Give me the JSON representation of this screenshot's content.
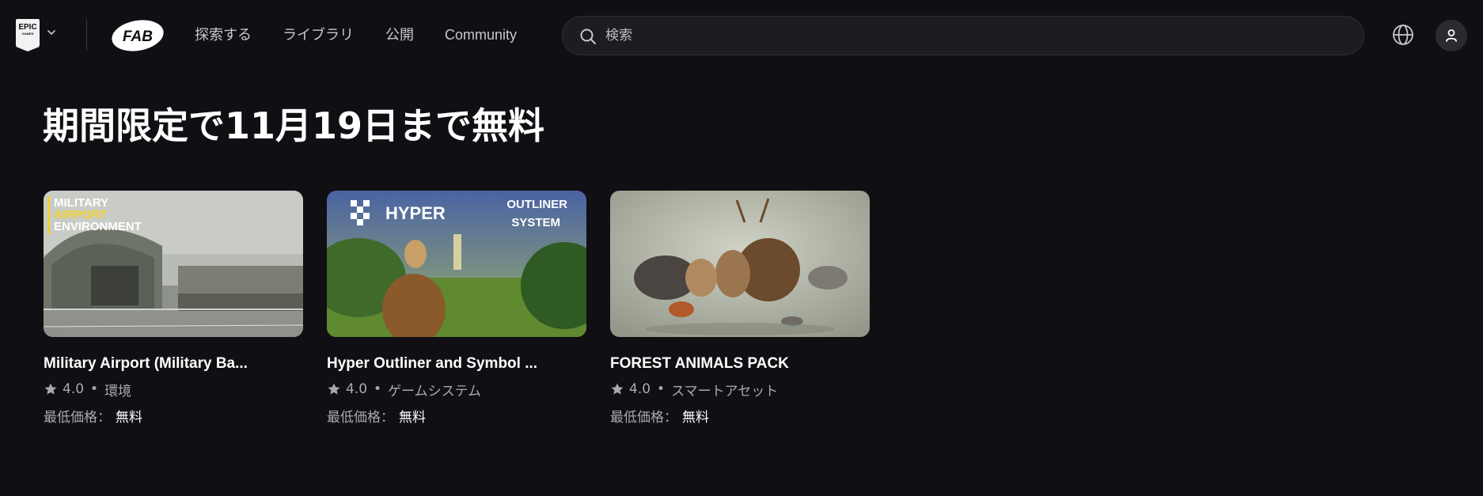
{
  "header": {
    "epic_logo": {
      "line1": "EPIC",
      "line2": "GAMES"
    },
    "fab_logo": "FAB",
    "nav": [
      "探索する",
      "ライブラリ",
      "公開",
      "Community"
    ],
    "search_placeholder": "検索",
    "icons": [
      "chevron-down-icon",
      "search-icon",
      "globe-icon",
      "user-icon"
    ]
  },
  "section": {
    "title": "期間限定で11月19日まで無料"
  },
  "cards": [
    {
      "title": "Military Airport (Military Ba...",
      "rating": "4.0",
      "category": "環境",
      "price_label": "最低価格：",
      "price_value": "無料",
      "thumb_text": [
        "MILITARY",
        "AIRPORT",
        "ENVIRONMENT"
      ]
    },
    {
      "title": "Hyper Outliner and Symbol ...",
      "rating": "4.0",
      "category": "ゲームシステム",
      "price_label": "最低価格：",
      "price_value": "無料",
      "thumb_text": [
        "HYPER",
        "OUTLINER",
        "SYSTEM"
      ]
    },
    {
      "title": "FOREST ANIMALS PACK",
      "rating": "4.0",
      "category": "スマートアセット",
      "price_label": "最低価格：",
      "price_value": "無料"
    }
  ],
  "meta_separator": "•",
  "colors": {
    "background": "#101014",
    "text": "#ffffff",
    "muted": "#a9a9ae",
    "airport_accent": "#f2d12e"
  }
}
